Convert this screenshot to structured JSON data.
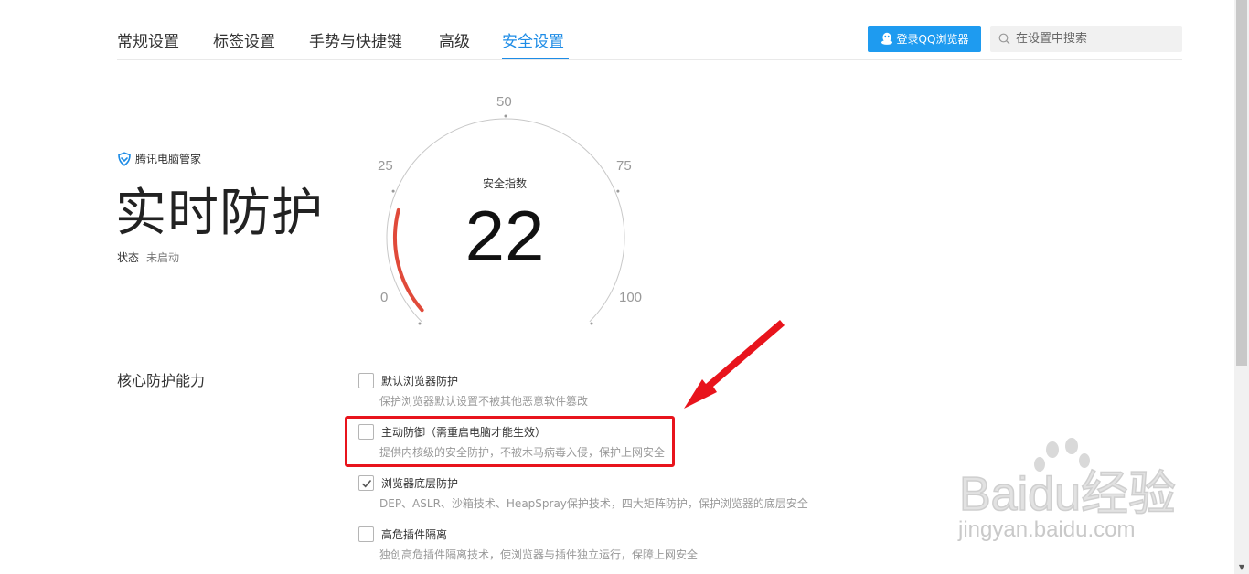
{
  "tabs": [
    {
      "label": "常规设置"
    },
    {
      "label": "标签设置"
    },
    {
      "label": "手势与快捷键"
    },
    {
      "label": "高级"
    },
    {
      "label": "安全设置"
    }
  ],
  "active_tab": "安全设置",
  "header": {
    "login_label": "登录QQ浏览器",
    "search_placeholder": "在设置中搜索"
  },
  "hero": {
    "brand": "腾讯电脑管家",
    "title": "实时防护",
    "status_label": "状态",
    "status_value": "未启动"
  },
  "gauge": {
    "label": "安全指数",
    "value": "22",
    "score": 22,
    "ticks": [
      "0",
      "25",
      "50",
      "75",
      "100"
    ],
    "accent_color": "#e04a3a"
  },
  "core": {
    "title": "核心防护能力",
    "options": [
      {
        "label": "默认浏览器防护",
        "desc": "保护浏览器默认设置不被其他恶意软件篡改",
        "checked": false
      },
      {
        "label": "主动防御（需重启电脑才能生效）",
        "desc": "提供内核级的安全防护，不被木马病毒入侵，保护上网安全",
        "checked": false
      },
      {
        "label": "浏览器底层防护",
        "desc": "DEP、ASLR、沙箱技术、HeapSpray保护技术，四大矩阵防护，保护浏览器的底层安全",
        "checked": true
      },
      {
        "label": "高危插件隔离",
        "desc": "独创高危插件隔离技术，使浏览器与插件独立运行，保障上网安全",
        "checked": false
      }
    ]
  },
  "watermark": {
    "logo": "Baidu经验",
    "url": "jingyan.baidu.com"
  },
  "colors": {
    "accent": "#1e8ce6",
    "button": "#1e9bf0",
    "highlight": "#e8141c"
  }
}
